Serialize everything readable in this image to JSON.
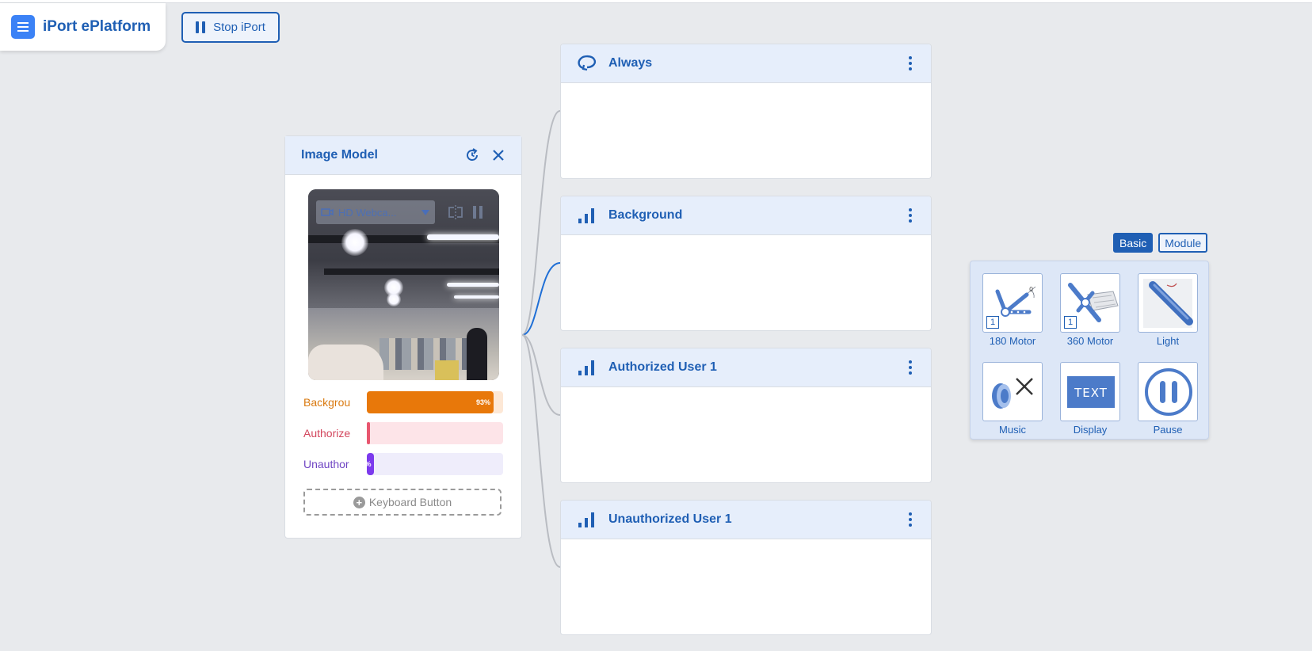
{
  "app": {
    "title": "iPort ePlatform"
  },
  "toolbar": {
    "stop_label": "Stop iPort"
  },
  "image_model": {
    "title": "Image Model",
    "camera": {
      "selected_device": "HD Webca..."
    },
    "classes": [
      {
        "label": "Backgrou",
        "fill": 0.93,
        "value_text": "93%",
        "color": "#e8780a",
        "track": "#fde8d6",
        "text_color": "#d9790f"
      },
      {
        "label": "Authorize",
        "fill": 0.0,
        "value_text": "",
        "color": "#e8566f",
        "track": "#fde4e8",
        "text_color": "#d2455c"
      },
      {
        "label": "Unauthor",
        "fill": 0.05,
        "value_text": "%",
        "color": "#7c3aed",
        "track": "#efedfb",
        "text_color": "#7046c4"
      }
    ],
    "keyboard_button": {
      "label": "Keyboard Button"
    }
  },
  "blocks": [
    {
      "title": "Always",
      "icon": "loop-icon"
    },
    {
      "title": "Background",
      "icon": "signal-bars-icon"
    },
    {
      "title": "Authorized User 1",
      "icon": "signal-bars-icon"
    },
    {
      "title": "Unauthorized User 1",
      "icon": "signal-bars-icon"
    }
  ],
  "palette": {
    "tabs": [
      {
        "label": "Basic",
        "active": true
      },
      {
        "label": "Module",
        "active": false
      }
    ],
    "tiles": [
      {
        "label": "180 Motor",
        "icon": "servo-180-icon",
        "badge": "1"
      },
      {
        "label": "360 Motor",
        "icon": "servo-360-icon",
        "badge": "1"
      },
      {
        "label": "Light",
        "icon": "led-strip-icon"
      },
      {
        "label": "Music",
        "icon": "speaker-muted-icon"
      },
      {
        "label": "Display",
        "icon": "display-text-icon",
        "text": "TEXT"
      },
      {
        "label": "Pause",
        "icon": "pause-circle-icon"
      }
    ]
  },
  "colors": {
    "accent": "#1f5fb4",
    "connector_active": "#1f6fd6",
    "connector_idle": "#b9bcc2"
  }
}
